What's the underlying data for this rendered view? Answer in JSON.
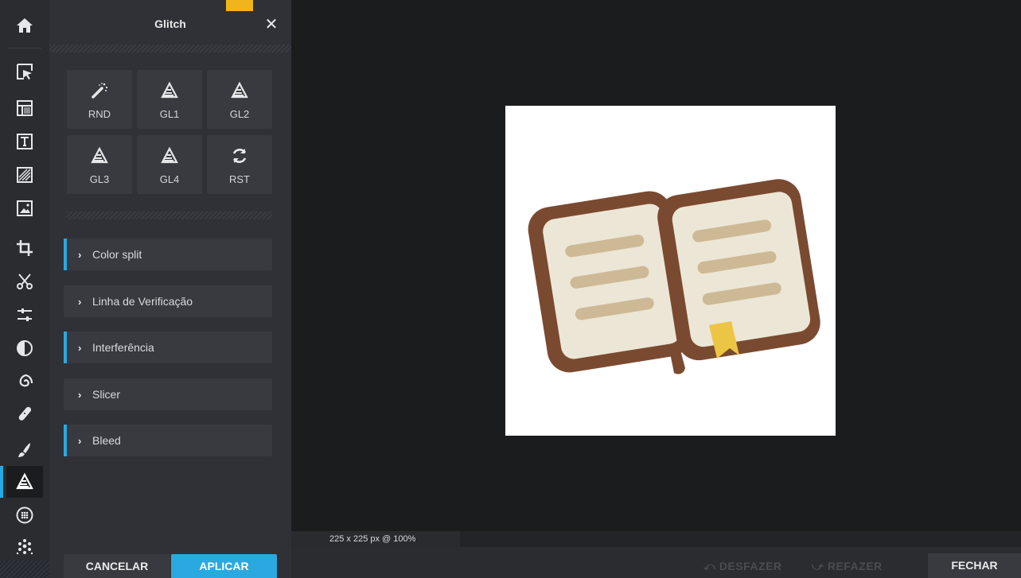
{
  "panel": {
    "title": "Glitch",
    "close_icon": "close-icon",
    "presets": [
      {
        "label": "RND",
        "icon": "magic-wand-icon"
      },
      {
        "label": "GL1",
        "icon": "glitch-triangle-icon"
      },
      {
        "label": "GL2",
        "icon": "glitch-triangle-icon"
      },
      {
        "label": "GL3",
        "icon": "glitch-triangle-icon"
      },
      {
        "label": "GL4",
        "icon": "glitch-triangle-icon"
      },
      {
        "label": "RST",
        "icon": "reset-icon"
      }
    ],
    "sections": [
      {
        "label": "Color split",
        "marked": true
      },
      {
        "label": "Linha de Verificação",
        "marked": false
      },
      {
        "label": "Interferência",
        "marked": true
      },
      {
        "label": "Slicer",
        "marked": false
      },
      {
        "label": "Bleed",
        "marked": true
      }
    ],
    "cancel_label": "CANCELAR",
    "apply_label": "APLICAR"
  },
  "toolbar": {
    "tools": [
      "home-icon",
      "select-icon",
      "layout-icon",
      "text-icon",
      "texture-icon",
      "image-icon",
      "crop-icon",
      "cut-icon",
      "adjust-icon",
      "contrast-icon",
      "spiral-icon",
      "bandage-icon",
      "brush-icon",
      "glitch-icon",
      "dots-circle-icon",
      "particles-icon"
    ],
    "active": "glitch-icon"
  },
  "canvas": {
    "status": "225 x 225 px @ 100%",
    "undo_label": "DESFAZER",
    "redo_label": "REFAZER",
    "close_label": "FECHAR"
  },
  "colors": {
    "accent_blue": "#2aa9e0",
    "accent_yellow": "#f1b51c",
    "book_brown": "#7a4a30",
    "book_page": "#ece6d6",
    "book_lines": "#cdb995",
    "bookmark": "#ecc544"
  }
}
